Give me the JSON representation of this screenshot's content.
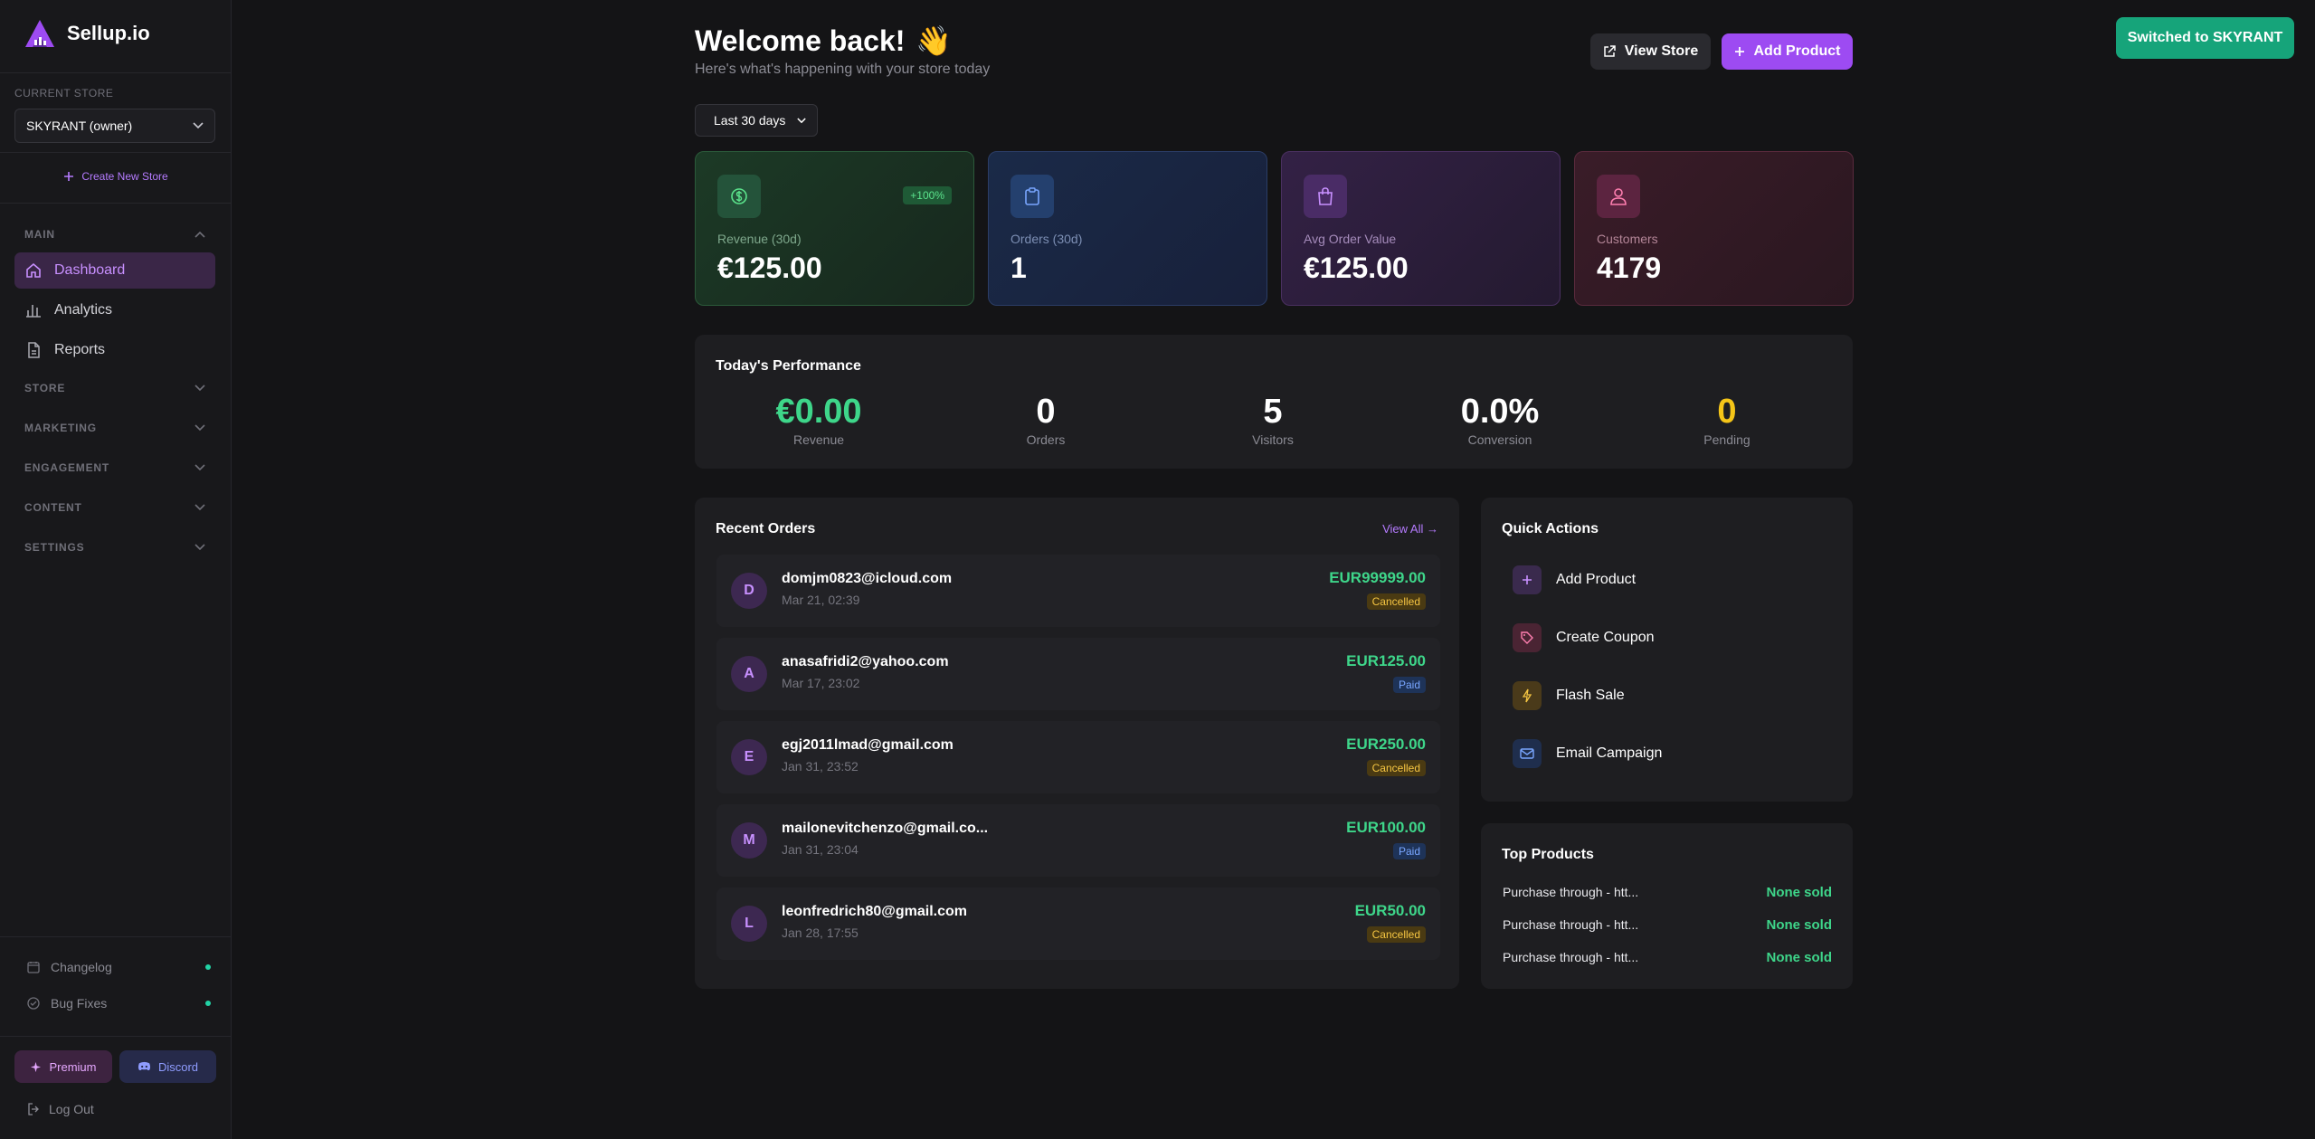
{
  "brand": {
    "name": "Sellup.io"
  },
  "sidebar": {
    "store_label": "CURRENT STORE",
    "store_value": "SKYRANT (owner)",
    "create_store": "Create New Store",
    "sections": {
      "main": "MAIN",
      "store": "STORE",
      "marketing": "MARKETING",
      "engagement": "ENGAGEMENT",
      "content": "CONTENT",
      "settings": "SETTINGS"
    },
    "items": [
      {
        "label": "Dashboard",
        "icon": "home-icon",
        "active": true
      },
      {
        "label": "Analytics",
        "icon": "bar-chart-icon",
        "active": false
      },
      {
        "label": "Reports",
        "icon": "document-icon",
        "active": false
      }
    ],
    "footer": {
      "changelog": "Changelog",
      "bug_fixes": "Bug Fixes",
      "premium": "Premium",
      "discord": "Discord",
      "logout": "Log Out"
    }
  },
  "header": {
    "title": "Welcome back!",
    "emoji": "👋",
    "subtitle": "Here's what's happening with your store today",
    "view_store": "View Store",
    "add_product": "Add Product",
    "toast": "Switched to SKYRANT",
    "range": "Last 30 days"
  },
  "stats": [
    {
      "label": "Revenue (30d)",
      "value": "€125.00",
      "badge": "+100%",
      "icon": "dollar-icon"
    },
    {
      "label": "Orders (30d)",
      "value": "1",
      "icon": "clipboard-icon"
    },
    {
      "label": "Avg Order Value",
      "value": "€125.00",
      "icon": "shopping-bag-icon"
    },
    {
      "label": "Customers",
      "value": "4179",
      "icon": "users-icon"
    }
  ],
  "performance": {
    "title": "Today's Performance",
    "items": [
      {
        "value": "€0.00",
        "label": "Revenue",
        "color": "#3ed68a"
      },
      {
        "value": "0",
        "label": "Orders",
        "color": "#ffffff"
      },
      {
        "value": "5",
        "label": "Visitors",
        "color": "#ffffff"
      },
      {
        "value": "0.0%",
        "label": "Conversion",
        "color": "#ffffff"
      },
      {
        "value": "0",
        "label": "Pending",
        "color": "#f5c518"
      }
    ]
  },
  "orders": {
    "title": "Recent Orders",
    "view_all": "View All →",
    "rows": [
      {
        "initial": "D",
        "email": "domjm0823@icloud.com",
        "date": "Mar 21, 02:39",
        "amount": "EUR99999.00",
        "status": "Cancelled"
      },
      {
        "initial": "A",
        "email": "anasafridi2@yahoo.com",
        "date": "Mar 17, 23:02",
        "amount": "EUR125.00",
        "status": "Paid"
      },
      {
        "initial": "E",
        "email": "egj2011lmad@gmail.com",
        "date": "Jan 31, 23:52",
        "amount": "EUR250.00",
        "status": "Cancelled"
      },
      {
        "initial": "M",
        "email": "mailonevitchenzo@gmail.co...",
        "date": "Jan 31, 23:04",
        "amount": "EUR100.00",
        "status": "Paid"
      },
      {
        "initial": "L",
        "email": "leonfredrich80@gmail.com",
        "date": "Jan 28, 17:55",
        "amount": "EUR50.00",
        "status": "Cancelled"
      }
    ]
  },
  "quick_actions": {
    "title": "Quick Actions",
    "items": [
      {
        "label": "Add Product",
        "icon": "plus-icon"
      },
      {
        "label": "Create Coupon",
        "icon": "tag-icon"
      },
      {
        "label": "Flash Sale",
        "icon": "lightning-icon"
      },
      {
        "label": "Email Campaign",
        "icon": "mail-icon"
      }
    ]
  },
  "top_products": {
    "title": "Top Products",
    "items": [
      {
        "name": "Purchase through - htt...",
        "sold": "None sold"
      },
      {
        "name": "Purchase through - htt...",
        "sold": "None sold"
      },
      {
        "name": "Purchase through - htt...",
        "sold": "None sold"
      }
    ]
  }
}
